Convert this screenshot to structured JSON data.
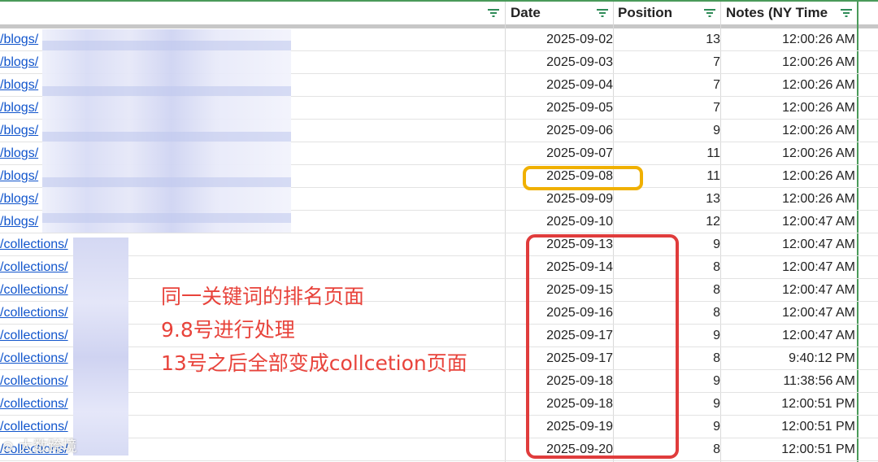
{
  "header": {
    "date": "Date",
    "position": "Position",
    "notes": "Notes  (NY Time"
  },
  "rows": [
    {
      "url": "/blogs/",
      "date": "2025-09-02",
      "position": "13",
      "time": "12:00:26 AM"
    },
    {
      "url": "/blogs/",
      "date": "2025-09-03",
      "position": "7",
      "time": "12:00:26 AM"
    },
    {
      "url": "/blogs/",
      "date": "2025-09-04",
      "position": "7",
      "time": "12:00:26 AM"
    },
    {
      "url": "/blogs/",
      "date": "2025-09-05",
      "position": "7",
      "time": "12:00:26 AM"
    },
    {
      "url": "/blogs/",
      "date": "2025-09-06",
      "position": "9",
      "time": "12:00:26 AM"
    },
    {
      "url": "/blogs/",
      "date": "2025-09-07",
      "position": "11",
      "time": "12:00:26 AM"
    },
    {
      "url": "/blogs/",
      "date": "2025-09-08",
      "position": "11",
      "time": "12:00:26 AM"
    },
    {
      "url": "/blogs/",
      "date": "2025-09-09",
      "position": "13",
      "time": "12:00:26 AM"
    },
    {
      "url": "/blogs/",
      "date": "2025-09-10",
      "position": "12",
      "time": "12:00:47 AM"
    },
    {
      "url": "/collections/",
      "date": "2025-09-13",
      "position": "9",
      "time": "12:00:47 AM"
    },
    {
      "url": "/collections/",
      "date": "2025-09-14",
      "position": "8",
      "time": "12:00:47 AM"
    },
    {
      "url": "/collections/",
      "date": "2025-09-15",
      "position": "8",
      "time": "12:00:47 AM"
    },
    {
      "url": "/collections/",
      "date": "2025-09-16",
      "position": "8",
      "time": "12:00:47 AM"
    },
    {
      "url": "/collections/",
      "date": "2025-09-17",
      "position": "9",
      "time": "12:00:47 AM"
    },
    {
      "url": "/collections/",
      "date": "2025-09-17",
      "position": "8",
      "time": "9:40:12 PM"
    },
    {
      "url": "/collections/",
      "date": "2025-09-18",
      "position": "9",
      "time": "11:38:56 AM"
    },
    {
      "url": "/collections/",
      "date": "2025-09-18",
      "position": "9",
      "time": "12:00:51 PM"
    },
    {
      "url": "/collections/",
      "date": "2025-09-19",
      "position": "9",
      "time": "12:00:51 PM"
    },
    {
      "url": "/collections/",
      "date": "2025-09-20",
      "position": "8",
      "time": "12:00:51 PM"
    }
  ],
  "annotation": {
    "line1": "同一关键词的排名页面",
    "line2": "9.8号进行处理",
    "line3": "13号之后全部变成collcetion页面"
  },
  "watermark": "⊙ 大数跨境",
  "colors": {
    "link": "#1155cc",
    "highlight_yellow": "#f0b000",
    "highlight_red": "#e03c3c",
    "annotation_text": "#e8433b",
    "frozen_border": "#4a9a5a"
  }
}
